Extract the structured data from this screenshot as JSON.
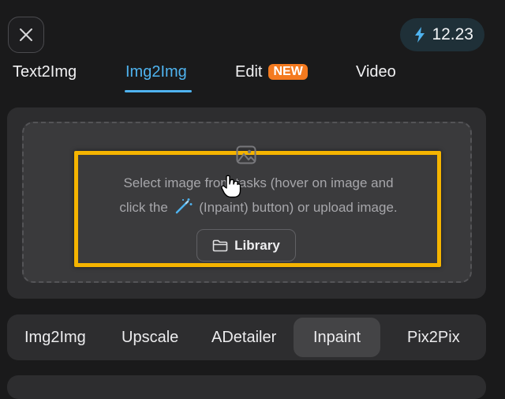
{
  "header": {
    "close_icon": "close-icon",
    "credits": {
      "icon": "lightning-bolt-icon",
      "value": "12.23"
    }
  },
  "tabs": [
    {
      "label": "Text2Img",
      "active": false
    },
    {
      "label": "Img2Img",
      "active": true
    },
    {
      "label": "Edit",
      "active": false,
      "badge": "NEW"
    },
    {
      "label": "Video",
      "active": false
    }
  ],
  "upload": {
    "icon": "image-icon",
    "hint_line1": "Select image from tasks (hover on image and",
    "hint_line2_before": "click the",
    "hint_line2_after": "(Inpaint) button) or upload image.",
    "wand_icon": "magic-wand-icon",
    "library_label": "Library",
    "library_icon": "folder-icon"
  },
  "modes": [
    {
      "label": "Img2Img",
      "active": false
    },
    {
      "label": "Upscale",
      "active": false
    },
    {
      "label": "ADetailer",
      "active": false
    },
    {
      "label": "Inpaint",
      "active": true
    },
    {
      "label": "Pix2Pix",
      "active": false
    }
  ],
  "colors": {
    "accent": "#4fb3ef",
    "badge": "#f47a1f",
    "highlight": "#f5b400",
    "background": "#1a1a1b",
    "panel": "#2d2d2f"
  }
}
